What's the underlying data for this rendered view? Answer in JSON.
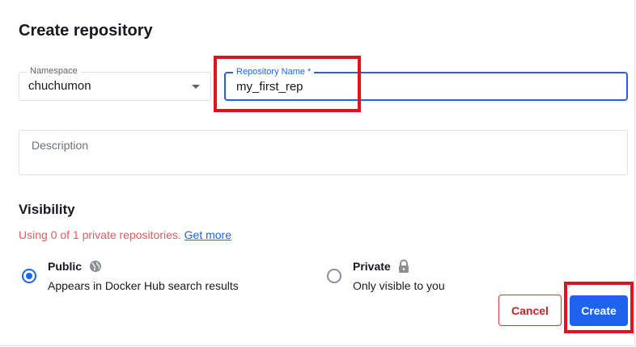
{
  "page": {
    "title": "Create repository"
  },
  "form": {
    "namespace": {
      "label": "Namespace",
      "value": "chuchumon",
      "icon": "chevron-down-icon"
    },
    "repository_name": {
      "label": "Repository Name *",
      "value": "my_first_rep"
    },
    "description": {
      "placeholder": "Description",
      "value": ""
    }
  },
  "visibility": {
    "title": "Visibility",
    "usage_text": "Using 0 of 1 private repositories.",
    "usage_link": "Get more",
    "usage_color": "#e25a5a",
    "options": [
      {
        "title": "Public",
        "description": "Appears in Docker Hub search results",
        "icon": "globe-icon",
        "selected": true
      },
      {
        "title": "Private",
        "description": "Only visible to you",
        "icon": "lock-icon",
        "selected": false
      }
    ]
  },
  "actions": {
    "cancel_label": "Cancel",
    "create_label": "Create"
  },
  "colors": {
    "accent": "#1d63ed",
    "highlight": "#e3101e",
    "danger": "#c7222a"
  }
}
